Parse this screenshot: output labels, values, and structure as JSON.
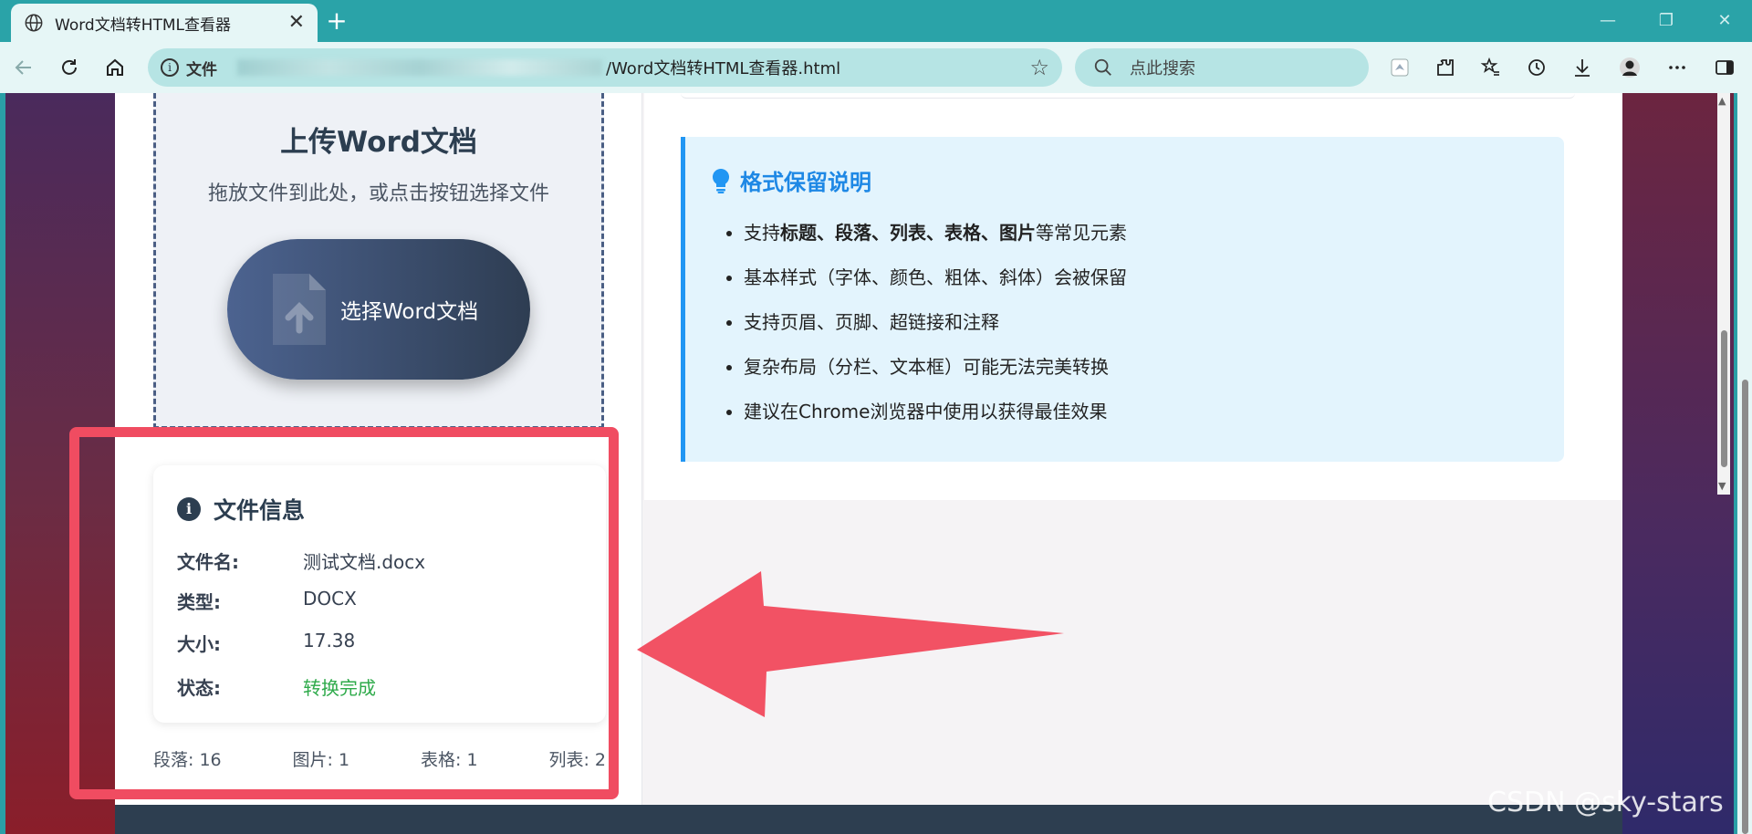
{
  "browser": {
    "tab_title": "Word文档转HTML查看器",
    "tab_close": "✕",
    "new_tab": "+",
    "address_scheme": "文件",
    "address_path": "/Word文档转HTML查看器.html",
    "search_placeholder": "点此搜索",
    "window_controls": [
      "—",
      "❐",
      "✕"
    ]
  },
  "upload": {
    "title": "上传Word文档",
    "subtitle": "拖放文件到此处，或点击按钮选择文件",
    "button_label": "选择Word文档"
  },
  "file_info": {
    "heading": "文件信息",
    "icon": "info-icon",
    "rows": [
      {
        "key": "文件名:",
        "value": "测试文档.docx"
      },
      {
        "key": "类型:",
        "value": "DOCX"
      },
      {
        "key": "大小:",
        "value": "17.38"
      },
      {
        "key": "状态:",
        "value": "转换完成"
      }
    ],
    "status_color": "#2eaa4a"
  },
  "stats": [
    {
      "label": "段落: 16"
    },
    {
      "label": "图片: 1"
    },
    {
      "label": "表格: 1"
    },
    {
      "label": "列表: 2"
    }
  ],
  "notes": {
    "heading": "格式保留说明",
    "icon": "lightbulb-icon",
    "item1_prefix": "支持",
    "item1_bold": "标题、段落、列表、表格、图片",
    "item1_suffix": "等常见元素",
    "item2": "基本样式（字体、颜色、粗体、斜体）会被保留",
    "item3": "支持页眉、页脚、超链接和注释",
    "item4": "复杂布局（分栏、文本框）可能无法完美转换",
    "item5": "建议在Chrome浏览器中使用以获得最佳效果"
  },
  "watermark": "CSDN @sky-stars",
  "colors": {
    "accent_blue": "#2196f3",
    "annotation_red": "#f04c61",
    "button_gradient_start": "#4c6390",
    "button_gradient_end": "#2e3d52"
  }
}
